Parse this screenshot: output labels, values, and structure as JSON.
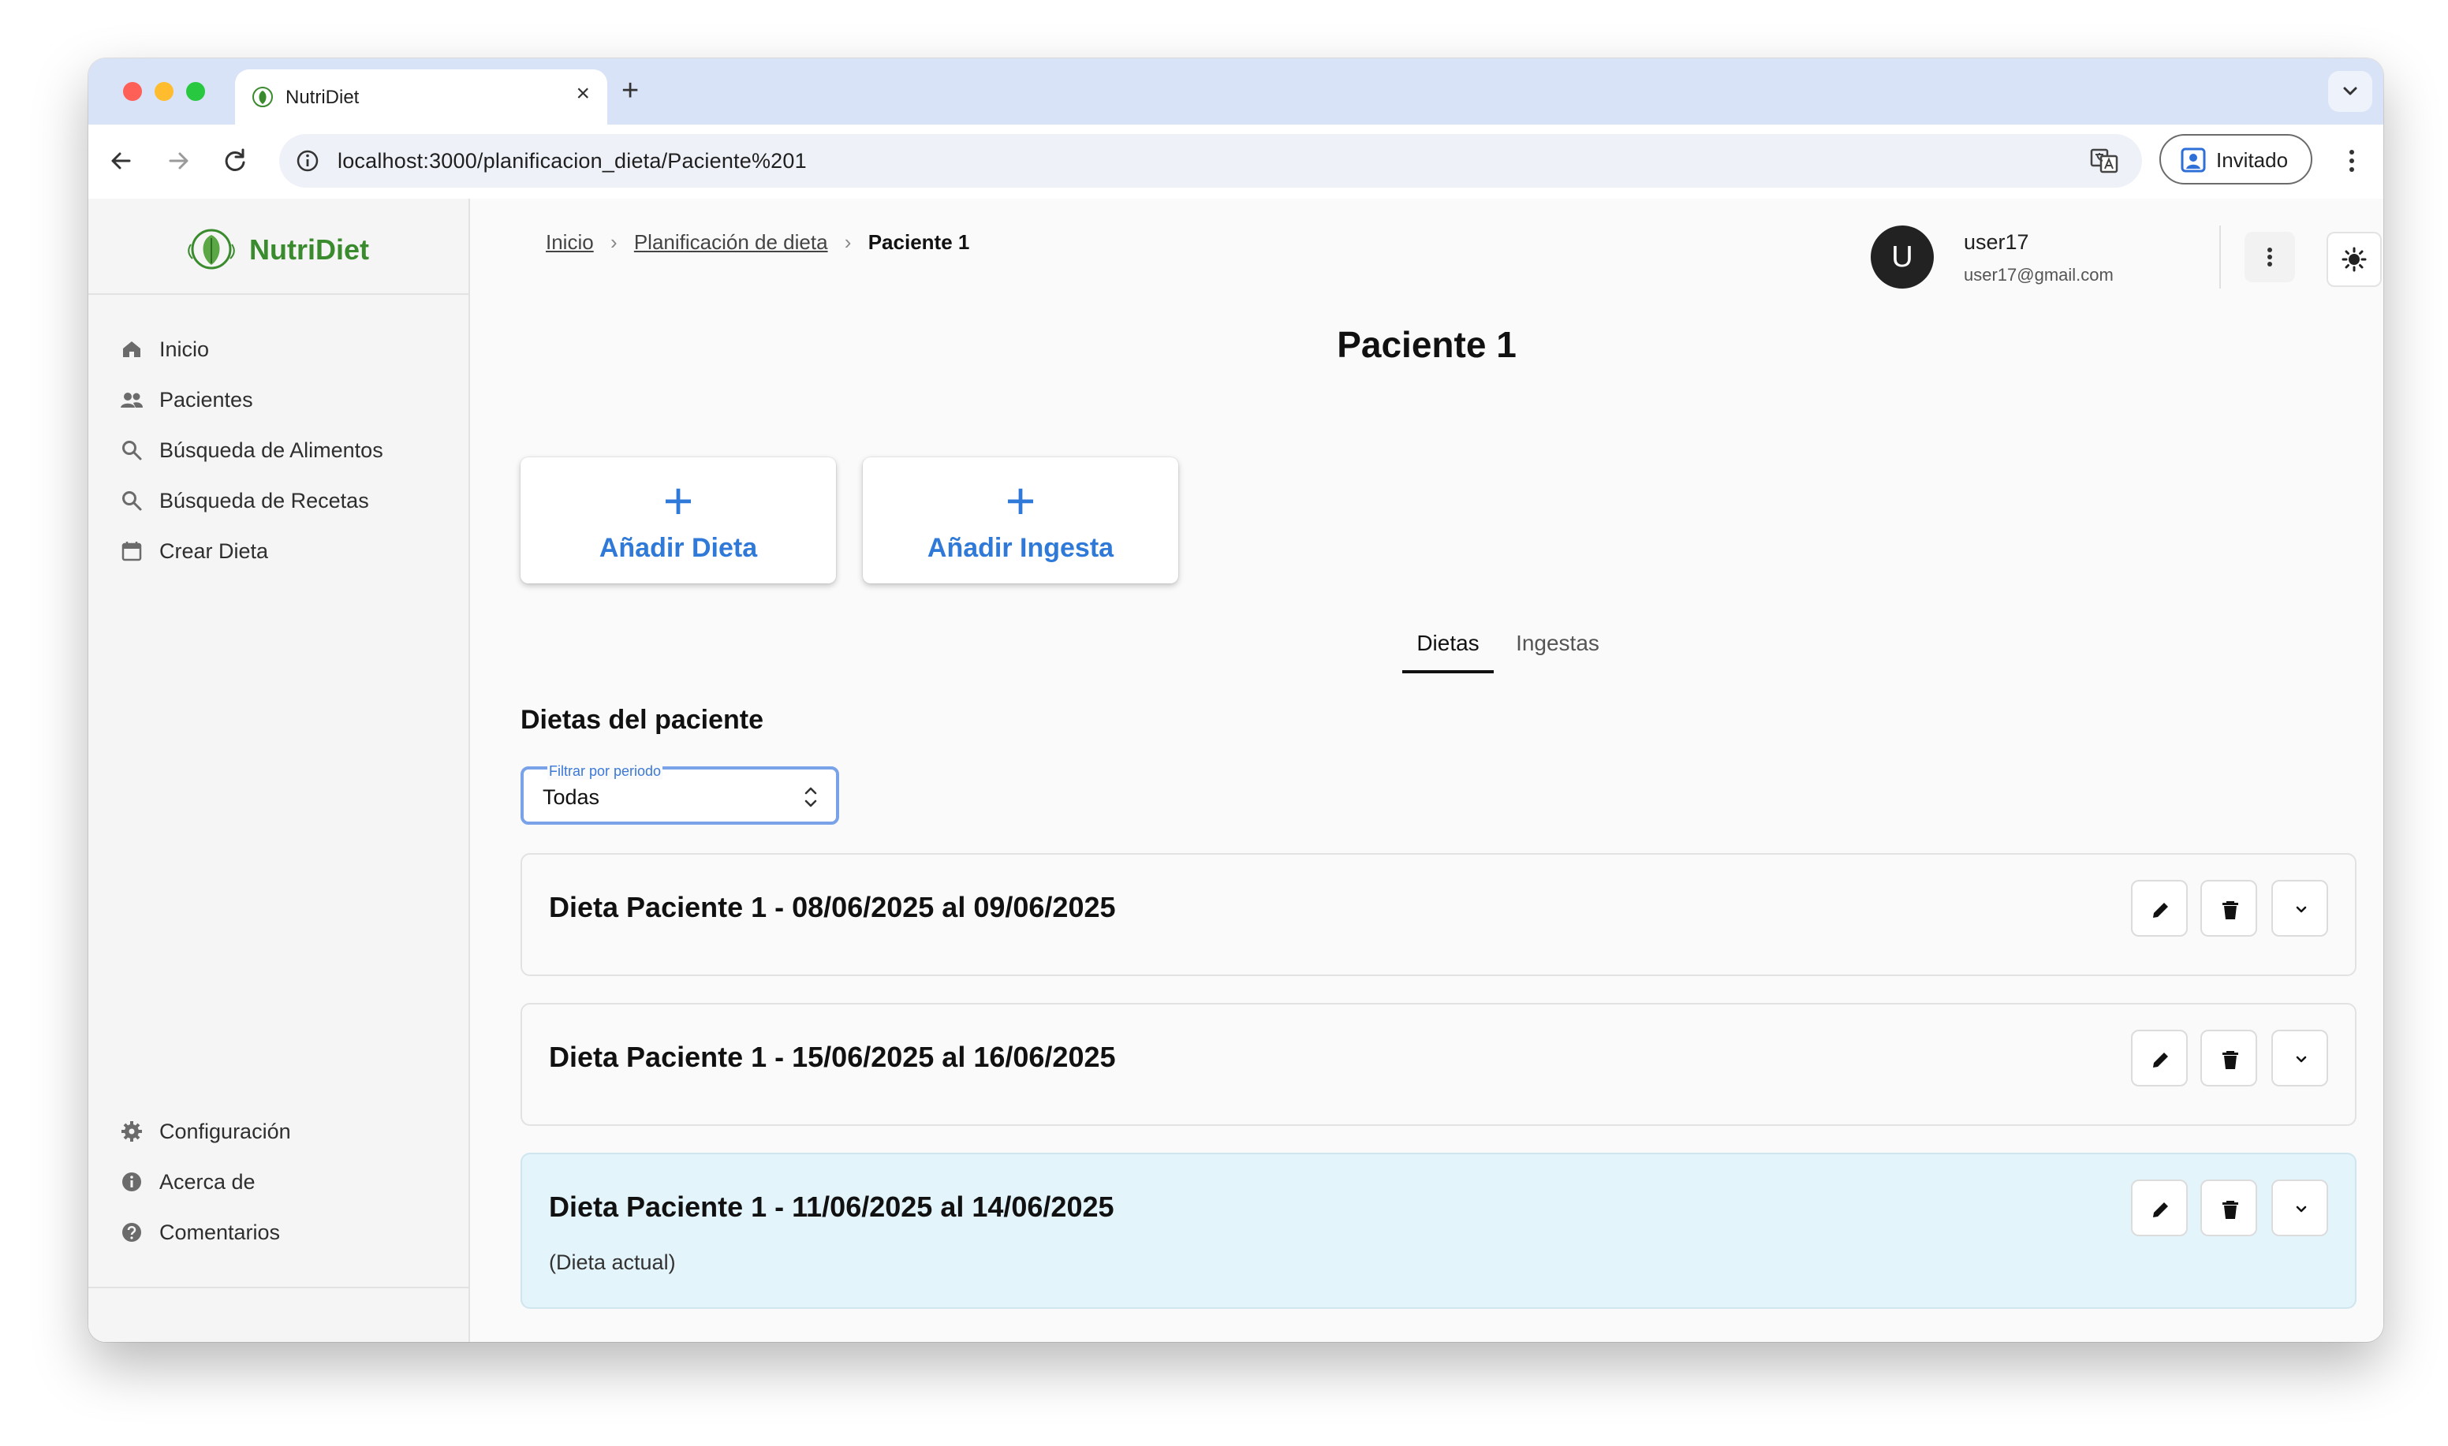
{
  "browser": {
    "tab_title": "NutriDiet",
    "tab_close": "×",
    "new_tab": "+",
    "url": "localhost:3000/planificacion_dieta/Paciente%201",
    "profile_label": "Invitado"
  },
  "sidebar": {
    "brand": "NutriDiet",
    "items": [
      {
        "label": "Inicio",
        "icon": "home-icon"
      },
      {
        "label": "Pacientes",
        "icon": "people-icon"
      },
      {
        "label": "Búsqueda de Alimentos",
        "icon": "search-icon"
      },
      {
        "label": "Búsqueda de Recetas",
        "icon": "search-icon"
      },
      {
        "label": "Crear Dieta",
        "icon": "calendar-icon"
      }
    ],
    "bottom_items": [
      {
        "label": "Configuración",
        "icon": "gear-icon"
      },
      {
        "label": "Acerca de",
        "icon": "info-icon"
      },
      {
        "label": "Comentarios",
        "icon": "help-icon"
      }
    ]
  },
  "header": {
    "breadcrumb": [
      "Inicio",
      "Planificación de dieta",
      "Paciente 1"
    ],
    "breadcrumb_sep": "›",
    "user": {
      "initial": "U",
      "name": "user17",
      "email": "user17@gmail.com"
    }
  },
  "page": {
    "title": "Paciente 1",
    "actions": [
      {
        "plus": "+",
        "label": "Añadir Dieta"
      },
      {
        "plus": "+",
        "label": "Añadir Ingesta"
      }
    ],
    "tabs": [
      {
        "label": "Dietas",
        "active": true
      },
      {
        "label": "Ingestas",
        "active": false
      }
    ],
    "section_title": "Dietas del paciente",
    "filter": {
      "label": "Filtrar por periodo",
      "value": "Todas"
    },
    "diets": [
      {
        "title": "Dieta Paciente 1 - 08/06/2025 al 09/06/2025",
        "note": "",
        "current": false
      },
      {
        "title": "Dieta Paciente 1 - 15/06/2025 al 16/06/2025",
        "note": "",
        "current": false
      },
      {
        "title": "Dieta Paciente 1 - 11/06/2025 al 14/06/2025",
        "note": "(Dieta actual)",
        "current": true
      }
    ]
  },
  "colors": {
    "brand_green": "#3a8a2e",
    "accent_blue": "#2f7ad8",
    "current_diet_bg": "#e3f4fa"
  }
}
